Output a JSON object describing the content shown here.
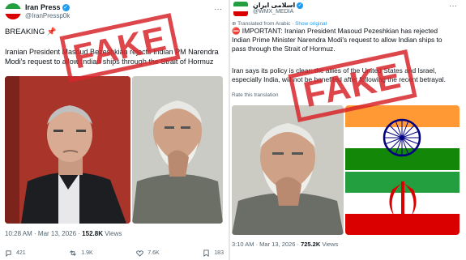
{
  "left": {
    "account_name": "Iran Press",
    "handle": "@IranPressp0k",
    "heading": "BREAKING 📌",
    "line1": "Iranian President Masoud Bezeshkian rejects Indian PM Narendra",
    "line2": "Modi's request to allow Indian ships through the Strait of Hormuz",
    "stamp": "FAKE",
    "timestamp": "10:28 AM · Mar 13, 2026 ·",
    "views_count": "152.8K",
    "views_label": "Views",
    "actions": {
      "replies": "421",
      "reposts": "1.9K",
      "likes": "7.6K",
      "bookmarks": "183"
    }
  },
  "right": {
    "account_name": "اسلامی ایران",
    "handle": "@WMX_MEDIA",
    "translated_note": "Translated from Arabic ·",
    "show_original": "Show original",
    "line1": "⛔ IMPORTANT: Iranian President Masoud Pezeshkian has rejected",
    "line2": "Indian Prime Minister Narendra Modi's request to allow Indian ships to",
    "line3": "pass through the Strait of Hormuz.",
    "line4": "Iran says its policy is clear: the allies of the United States and Israel,",
    "line5": "especially India, will not be benefited after following the recent betrayal.",
    "rate_note": "Rate this translation",
    "stamp": "FAKE",
    "timestamp": "3:10 AM · Mar 13, 2026 ·",
    "views_count": "725.2K",
    "views_label": "Views"
  },
  "colors": {
    "stamp_red": "#d8262b",
    "x_blue": "#1d9bf0",
    "iran_green": "#239f40",
    "iran_red": "#da0000",
    "india_saffron": "#ff9933",
    "india_green": "#138808",
    "ashoka_blue": "#000080"
  },
  "icons": [
    "reply-icon",
    "repost-icon",
    "like-icon",
    "bookmark-icon",
    "verified-icon",
    "more-icon",
    "translate-icon",
    "emblem-icon",
    "ashoka-chakra-icon"
  ]
}
